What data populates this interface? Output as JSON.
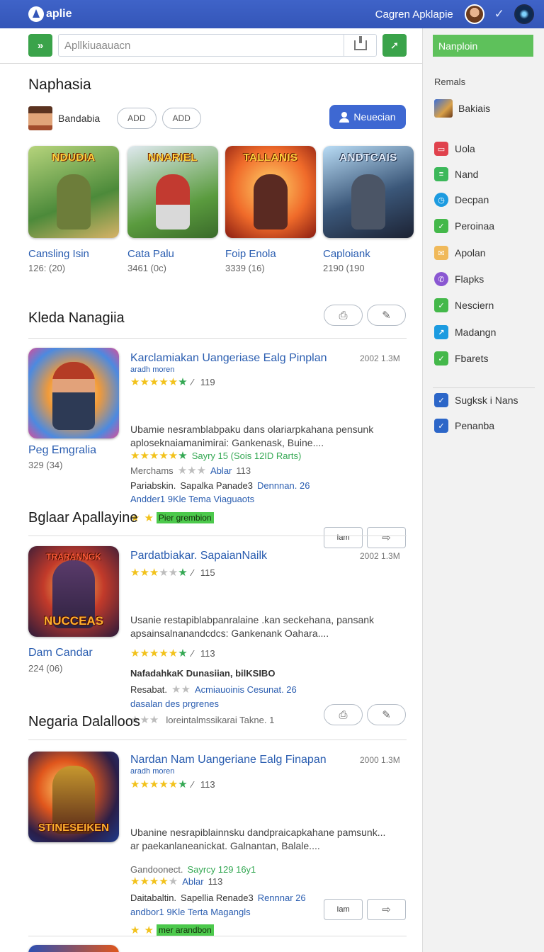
{
  "topbar": {
    "brand": "aplie",
    "title": "Cagren Apklapie",
    "check": "✓"
  },
  "search": {
    "go": "»",
    "placeholder": "Apllkiuaauacn",
    "submit": "➚"
  },
  "section1": {
    "heading": "Naphasia",
    "user_name": "Bandabia",
    "pill1": "ADD",
    "pill2": "ADD",
    "primary": "Neuecian",
    "featured": [
      {
        "title": "Cansling Isin",
        "meta": "126: (20)",
        "art": "NDUDIA",
        "c1": "#4c8a3a",
        "c2": "#d7b267",
        "fig": "#6d7d3a"
      },
      {
        "title": "Cata Palu",
        "meta": "3461 (0c)",
        "art": "NNARIEL",
        "c1": "#5a9b3e",
        "c2": "#c5d8e0",
        "fig": "#c23a30"
      },
      {
        "title": "Foip Enola",
        "meta": "3339 (16)",
        "art": "TALLANIS",
        "c1": "#ffb347",
        "c2": "#c4301c",
        "fig": "#5a2a22"
      },
      {
        "title": "Caploiank",
        "meta": "2190 (190",
        "art": "ANDTCAIS",
        "c1": "#86b5e0",
        "c2": "#29364f",
        "fig": "#4b5566"
      }
    ]
  },
  "section2": {
    "heading": "Kleda Nanagiia",
    "tool1": "⎙",
    "tool2": "✎",
    "name": "Peg Emgralia",
    "meta": "329 (34)",
    "title": "Karclamiakan Uangeriase Ealg Pinplan",
    "date": "2002 1.3M",
    "sub": "aradh moren",
    "rating": "119",
    "desc1": "Ubamie nesramblabpaku dans olariarpkahana pensunk",
    "desc2": "aploseknaiamanimirai: Gankenask, Buine....",
    "stars2_text": "Sayry 15 (Sois 12ID Rarts)",
    "l3_a": "Merchams",
    "l3_b": "Ablar",
    "l3_c": "113",
    "l4_a": "Pariabskin.",
    "l4_b": "Sapalka Panade3",
    "l4_c": "Dennnan. 26",
    "link": "Andder1 9Kle Tema Viaguaots",
    "badge": "Pier grembion",
    "btn1": "Iam",
    "btn2": "⇨"
  },
  "section3": {
    "heading": "Bglaar Apallayine",
    "name": "Dam Candar",
    "meta": "224 (06)",
    "art_top": "TRARANNGK",
    "art": "NUCCEAS",
    "title": "Pardatbiakar. SapaianNailk",
    "date": "2002 1.3M",
    "rating": "115",
    "desc1": "Usanie restapiblabpanralaine .kan seckehana, pansank",
    "desc2": "apsainsalnanandcdcs: Gankenank Oahara....",
    "rating2": "113",
    "bold": "NafadahkaK Dunasiian, bilKSIBO",
    "l4_a": "Resabat.",
    "l4_c": "Acmiauoinis Cesunat. 26",
    "link": "dasalan des prgrenes",
    "last": "loreintalmssikarai Takne. 1"
  },
  "section4": {
    "heading": "Negaria Dalalloos",
    "art": "STINESEIKEN",
    "title": "Nardan Nam Uangeriane Ealg Finapan",
    "date": "2000 1.3M",
    "sub": "aradh moren",
    "rating": "113",
    "desc1": "Ubanine nesrapiblainnsku dandpraicapkahane pamsunk...",
    "desc2": "ar paekanlaneanickat. Galnantan, Balale....",
    "l3_a": "Gandoonect.",
    "l3_b": "Sayrcy 129 16y1",
    "l4_a": "Ablar",
    "l4_b": "113",
    "l5_a": "Daitabaltin.",
    "l5_b": "Sapellia Renade3",
    "l5_c": "Rennnar 26",
    "link": "andbor1 9Kle Terta Magangls",
    "badge": "mer arandbon"
  },
  "sidebar": {
    "button": "Nanploin",
    "heading": "Remals",
    "feature": "Bakiais",
    "items": [
      {
        "label": "Uola",
        "icon": "layout-icon",
        "glyph": "▭",
        "color": "#e0424d"
      },
      {
        "label": "Nand",
        "icon": "list-icon",
        "glyph": "≡",
        "color": "#3cb85a"
      },
      {
        "label": "Decpan",
        "icon": "clock-icon",
        "glyph": "◷",
        "color": "#1c9be0"
      },
      {
        "label": "Peroinaa",
        "icon": "check-icon",
        "glyph": "✓",
        "color": "#44b84a"
      },
      {
        "label": "Apolan",
        "icon": "mail-icon",
        "glyph": "✉",
        "color": "#f0b95a"
      },
      {
        "label": "Flapks",
        "icon": "phone-icon",
        "glyph": "✆",
        "color": "#8a57d2"
      },
      {
        "label": "Nesciern",
        "icon": "check-icon",
        "glyph": "✓",
        "color": "#44b84a"
      },
      {
        "label": "Madangn",
        "icon": "share-icon",
        "glyph": "↗",
        "color": "#1c9be0"
      },
      {
        "label": "Fbarets",
        "icon": "check-icon",
        "glyph": "✓",
        "color": "#44b84a"
      },
      {
        "label": "Sugksk i Nans",
        "icon": "checkbox-icon",
        "glyph": "✓",
        "color": "#2c66c8"
      },
      {
        "label": "Penanba",
        "icon": "checkbox-icon",
        "glyph": "✓",
        "color": "#2c66c8"
      }
    ]
  },
  "colors": {
    "accent": "#3456b8",
    "green": "#3aa34a",
    "link": "#2a5db0",
    "star": "#f2c21c"
  }
}
